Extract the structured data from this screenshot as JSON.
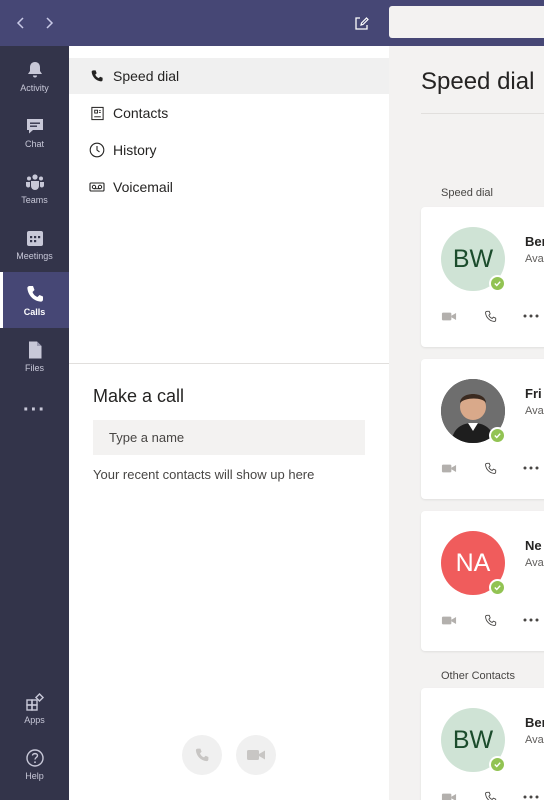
{
  "rail": {
    "items": [
      {
        "label": "Activity",
        "icon": "bell-icon"
      },
      {
        "label": "Chat",
        "icon": "chat-icon"
      },
      {
        "label": "Teams",
        "icon": "teams-icon"
      },
      {
        "label": "Meetings",
        "icon": "calendar-icon"
      },
      {
        "label": "Calls",
        "icon": "phone-icon",
        "active": true
      },
      {
        "label": "Files",
        "icon": "file-icon"
      }
    ],
    "more_label": "···",
    "apps_label": "Apps",
    "help_label": "Help"
  },
  "menu": {
    "items": [
      {
        "label": "Speed dial",
        "icon": "phone-icon",
        "active": true
      },
      {
        "label": "Contacts",
        "icon": "contacts-icon"
      },
      {
        "label": "History",
        "icon": "clock-icon"
      },
      {
        "label": "Voicemail",
        "icon": "voicemail-icon"
      }
    ]
  },
  "make_call": {
    "title": "Make a call",
    "placeholder": "Type a name",
    "recent_text": "Your recent contacts will show up here"
  },
  "speed_dial": {
    "title": "Speed dial",
    "section_label": "Speed dial",
    "other_section_label": "Other Contacts",
    "cards": [
      {
        "initials": "BW",
        "name": "Ben",
        "status": "Ava",
        "avatar_bg": "#cfe3d5",
        "avatar_fg": "#1b4c2c"
      },
      {
        "initials": "",
        "name": "Fri",
        "status": "Ava",
        "avatar_bg": "#555555",
        "avatar_fg": "#ffffff",
        "photo": true
      },
      {
        "initials": "NA",
        "name": "Ne",
        "status": "Ava",
        "avatar_bg": "#f05c5c",
        "avatar_fg": "#ffffff"
      },
      {
        "initials": "BW",
        "name": "Ber",
        "status": "Ava",
        "avatar_bg": "#cfe3d5",
        "avatar_fg": "#1b4c2c"
      }
    ]
  },
  "colors": {
    "topbar": "#464775",
    "rail": "#33344a",
    "presence": "#92c353"
  }
}
